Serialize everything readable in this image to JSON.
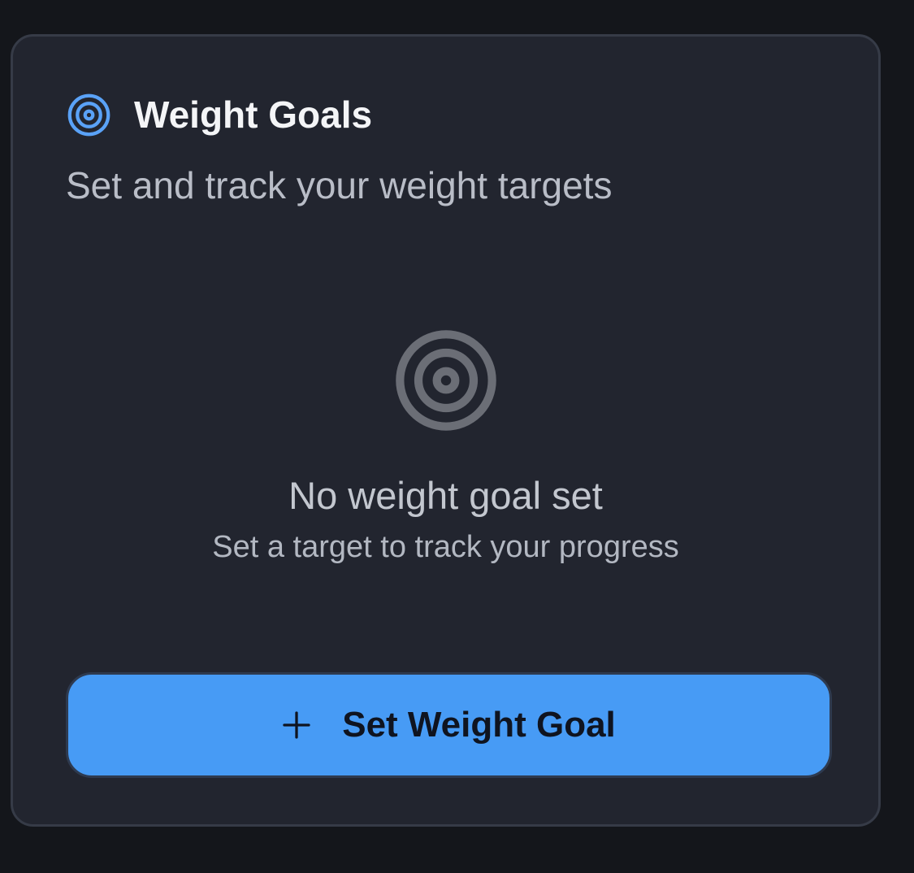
{
  "card": {
    "icon": "target-icon",
    "title": "Weight Goals",
    "subtitle": "Set and track your weight targets"
  },
  "empty_state": {
    "icon": "target-icon",
    "title": "No weight goal set",
    "description": "Set a target to track your progress"
  },
  "action": {
    "icon": "plus-icon",
    "label": "Set Weight Goal"
  },
  "colors": {
    "page_background": "#14161b",
    "card_background": "#22252f",
    "card_border": "#363b47",
    "accent": "#479bf5",
    "empty_icon": "#6b6e76"
  }
}
